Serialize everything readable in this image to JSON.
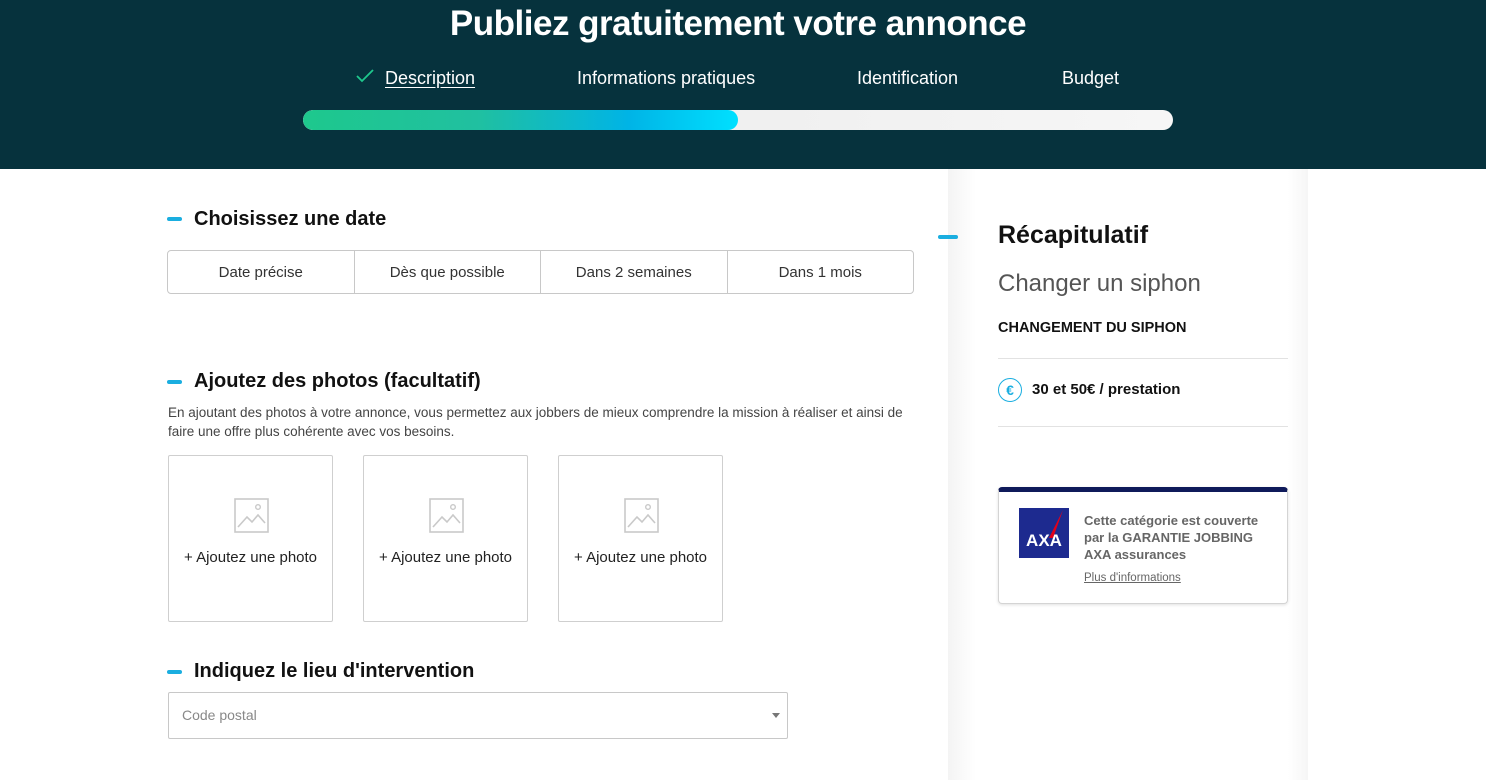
{
  "header": {
    "title": "Publiez gratuitement votre annonce",
    "steps": [
      {
        "label": "Description",
        "state": "completed"
      },
      {
        "label": "Informations pratiques",
        "state": "pending"
      },
      {
        "label": "Identification",
        "state": "pending"
      },
      {
        "label": "Budget",
        "state": "pending"
      }
    ],
    "progress_percent": 50
  },
  "date_section": {
    "title": "Choisissez une date",
    "options": [
      "Date précise",
      "Dès que possible",
      "Dans 2 semaines",
      "Dans 1 mois"
    ]
  },
  "photos_section": {
    "title": "Ajoutez des photos (facultatif)",
    "description": "En ajoutant des photos à votre annonce, vous permettez aux jobbers de mieux comprendre la mission à réaliser et ainsi de faire une offre plus cohérente avec vos besoins.",
    "slots": [
      "+ Ajoutez une photo",
      "+ Ajoutez une photo",
      "+ Ajoutez une photo"
    ]
  },
  "location_section": {
    "title": "Indiquez le lieu d'intervention",
    "postal_placeholder": "Code postal"
  },
  "recap": {
    "title": "Récapitulatif",
    "subtitle": "Changer un siphon",
    "category": "CHANGEMENT DU SIPHON",
    "price_icon": "€",
    "price": "30 et 50€ / prestation"
  },
  "insurance": {
    "logo_text": "AXA",
    "text": "Cette catégorie est couverte par la GARANTIE JOBBING AXA assurances",
    "link": "Plus d'informations"
  },
  "colors": {
    "header_bg": "#06323d",
    "accent": "#1aaee0",
    "progress_start": "#1ec88d",
    "progress_end": "#00e0ff",
    "axa_blue": "#1d2a8f",
    "axa_red": "#e2001a"
  }
}
